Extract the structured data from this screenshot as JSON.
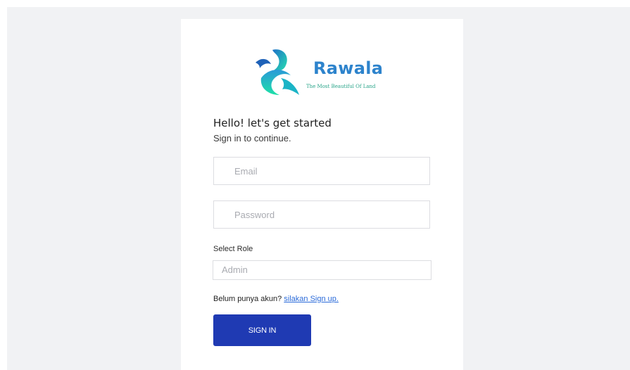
{
  "brand": {
    "name": "Rawala",
    "tagline": "The Most Beautiful Of Land",
    "icon": "bird-logo-icon",
    "colors": {
      "name": "#2d83cc",
      "tagline": "#2aa58a",
      "logo_dark": "#1e70c8",
      "logo_light": "#27e0b0"
    }
  },
  "form": {
    "heading": "Hello! let's get started",
    "subheading": "Sign in to continue.",
    "email_placeholder": "Email",
    "password_placeholder": "Password",
    "role_label": "Select Role",
    "role_value": "Admin",
    "signup_prompt": "Belum punya akun?",
    "signup_link": "silakan Sign up.",
    "submit_label": "SIGN IN"
  },
  "colors": {
    "background": "#f1f2f4",
    "card": "#ffffff",
    "primary_button": "#1f3ab3",
    "link": "#2a6ad9"
  }
}
